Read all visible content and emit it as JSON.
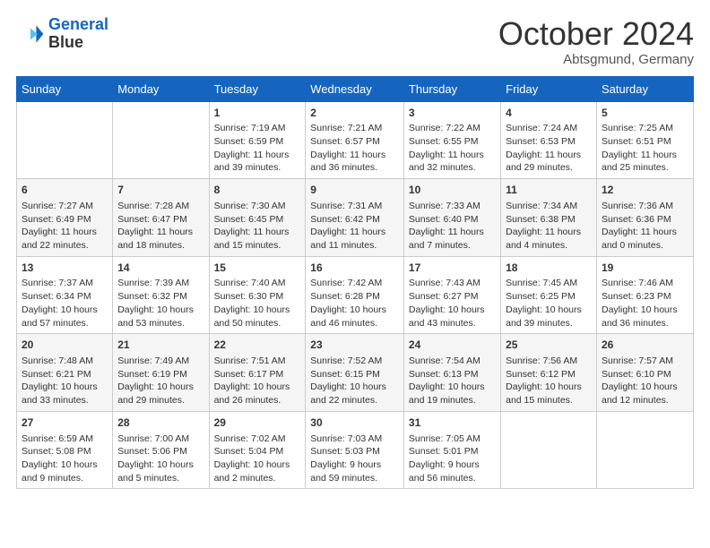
{
  "header": {
    "logo_line1": "General",
    "logo_line2": "Blue",
    "month_year": "October 2024",
    "location": "Abtsgmund, Germany"
  },
  "days_of_week": [
    "Sunday",
    "Monday",
    "Tuesday",
    "Wednesday",
    "Thursday",
    "Friday",
    "Saturday"
  ],
  "weeks": [
    [
      {
        "day": "",
        "info": ""
      },
      {
        "day": "",
        "info": ""
      },
      {
        "day": "1",
        "info": "Sunrise: 7:19 AM\nSunset: 6:59 PM\nDaylight: 11 hours and 39 minutes."
      },
      {
        "day": "2",
        "info": "Sunrise: 7:21 AM\nSunset: 6:57 PM\nDaylight: 11 hours and 36 minutes."
      },
      {
        "day": "3",
        "info": "Sunrise: 7:22 AM\nSunset: 6:55 PM\nDaylight: 11 hours and 32 minutes."
      },
      {
        "day": "4",
        "info": "Sunrise: 7:24 AM\nSunset: 6:53 PM\nDaylight: 11 hours and 29 minutes."
      },
      {
        "day": "5",
        "info": "Sunrise: 7:25 AM\nSunset: 6:51 PM\nDaylight: 11 hours and 25 minutes."
      }
    ],
    [
      {
        "day": "6",
        "info": "Sunrise: 7:27 AM\nSunset: 6:49 PM\nDaylight: 11 hours and 22 minutes."
      },
      {
        "day": "7",
        "info": "Sunrise: 7:28 AM\nSunset: 6:47 PM\nDaylight: 11 hours and 18 minutes."
      },
      {
        "day": "8",
        "info": "Sunrise: 7:30 AM\nSunset: 6:45 PM\nDaylight: 11 hours and 15 minutes."
      },
      {
        "day": "9",
        "info": "Sunrise: 7:31 AM\nSunset: 6:42 PM\nDaylight: 11 hours and 11 minutes."
      },
      {
        "day": "10",
        "info": "Sunrise: 7:33 AM\nSunset: 6:40 PM\nDaylight: 11 hours and 7 minutes."
      },
      {
        "day": "11",
        "info": "Sunrise: 7:34 AM\nSunset: 6:38 PM\nDaylight: 11 hours and 4 minutes."
      },
      {
        "day": "12",
        "info": "Sunrise: 7:36 AM\nSunset: 6:36 PM\nDaylight: 11 hours and 0 minutes."
      }
    ],
    [
      {
        "day": "13",
        "info": "Sunrise: 7:37 AM\nSunset: 6:34 PM\nDaylight: 10 hours and 57 minutes."
      },
      {
        "day": "14",
        "info": "Sunrise: 7:39 AM\nSunset: 6:32 PM\nDaylight: 10 hours and 53 minutes."
      },
      {
        "day": "15",
        "info": "Sunrise: 7:40 AM\nSunset: 6:30 PM\nDaylight: 10 hours and 50 minutes."
      },
      {
        "day": "16",
        "info": "Sunrise: 7:42 AM\nSunset: 6:28 PM\nDaylight: 10 hours and 46 minutes."
      },
      {
        "day": "17",
        "info": "Sunrise: 7:43 AM\nSunset: 6:27 PM\nDaylight: 10 hours and 43 minutes."
      },
      {
        "day": "18",
        "info": "Sunrise: 7:45 AM\nSunset: 6:25 PM\nDaylight: 10 hours and 39 minutes."
      },
      {
        "day": "19",
        "info": "Sunrise: 7:46 AM\nSunset: 6:23 PM\nDaylight: 10 hours and 36 minutes."
      }
    ],
    [
      {
        "day": "20",
        "info": "Sunrise: 7:48 AM\nSunset: 6:21 PM\nDaylight: 10 hours and 33 minutes."
      },
      {
        "day": "21",
        "info": "Sunrise: 7:49 AM\nSunset: 6:19 PM\nDaylight: 10 hours and 29 minutes."
      },
      {
        "day": "22",
        "info": "Sunrise: 7:51 AM\nSunset: 6:17 PM\nDaylight: 10 hours and 26 minutes."
      },
      {
        "day": "23",
        "info": "Sunrise: 7:52 AM\nSunset: 6:15 PM\nDaylight: 10 hours and 22 minutes."
      },
      {
        "day": "24",
        "info": "Sunrise: 7:54 AM\nSunset: 6:13 PM\nDaylight: 10 hours and 19 minutes."
      },
      {
        "day": "25",
        "info": "Sunrise: 7:56 AM\nSunset: 6:12 PM\nDaylight: 10 hours and 15 minutes."
      },
      {
        "day": "26",
        "info": "Sunrise: 7:57 AM\nSunset: 6:10 PM\nDaylight: 10 hours and 12 minutes."
      }
    ],
    [
      {
        "day": "27",
        "info": "Sunrise: 6:59 AM\nSunset: 5:08 PM\nDaylight: 10 hours and 9 minutes."
      },
      {
        "day": "28",
        "info": "Sunrise: 7:00 AM\nSunset: 5:06 PM\nDaylight: 10 hours and 5 minutes."
      },
      {
        "day": "29",
        "info": "Sunrise: 7:02 AM\nSunset: 5:04 PM\nDaylight: 10 hours and 2 minutes."
      },
      {
        "day": "30",
        "info": "Sunrise: 7:03 AM\nSunset: 5:03 PM\nDaylight: 9 hours and 59 minutes."
      },
      {
        "day": "31",
        "info": "Sunrise: 7:05 AM\nSunset: 5:01 PM\nDaylight: 9 hours and 56 minutes."
      },
      {
        "day": "",
        "info": ""
      },
      {
        "day": "",
        "info": ""
      }
    ]
  ]
}
